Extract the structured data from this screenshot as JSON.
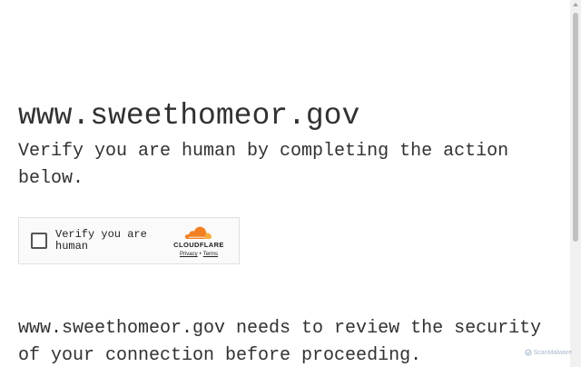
{
  "page": {
    "site_title": "www.sweethomeor.gov",
    "verify_message": "Verify you are human by completing the action below.",
    "review_message": "www.sweethomeor.gov needs to review the security of your connection before proceeding."
  },
  "widget": {
    "checkbox_label": "Verify you are human",
    "checked": false,
    "brand": "CLOUDFLARE",
    "privacy_link": "Privacy",
    "separator": "•",
    "terms_link": "Terms",
    "brand_color": "#f38020"
  },
  "watermark": {
    "text": "ScanMalware"
  }
}
